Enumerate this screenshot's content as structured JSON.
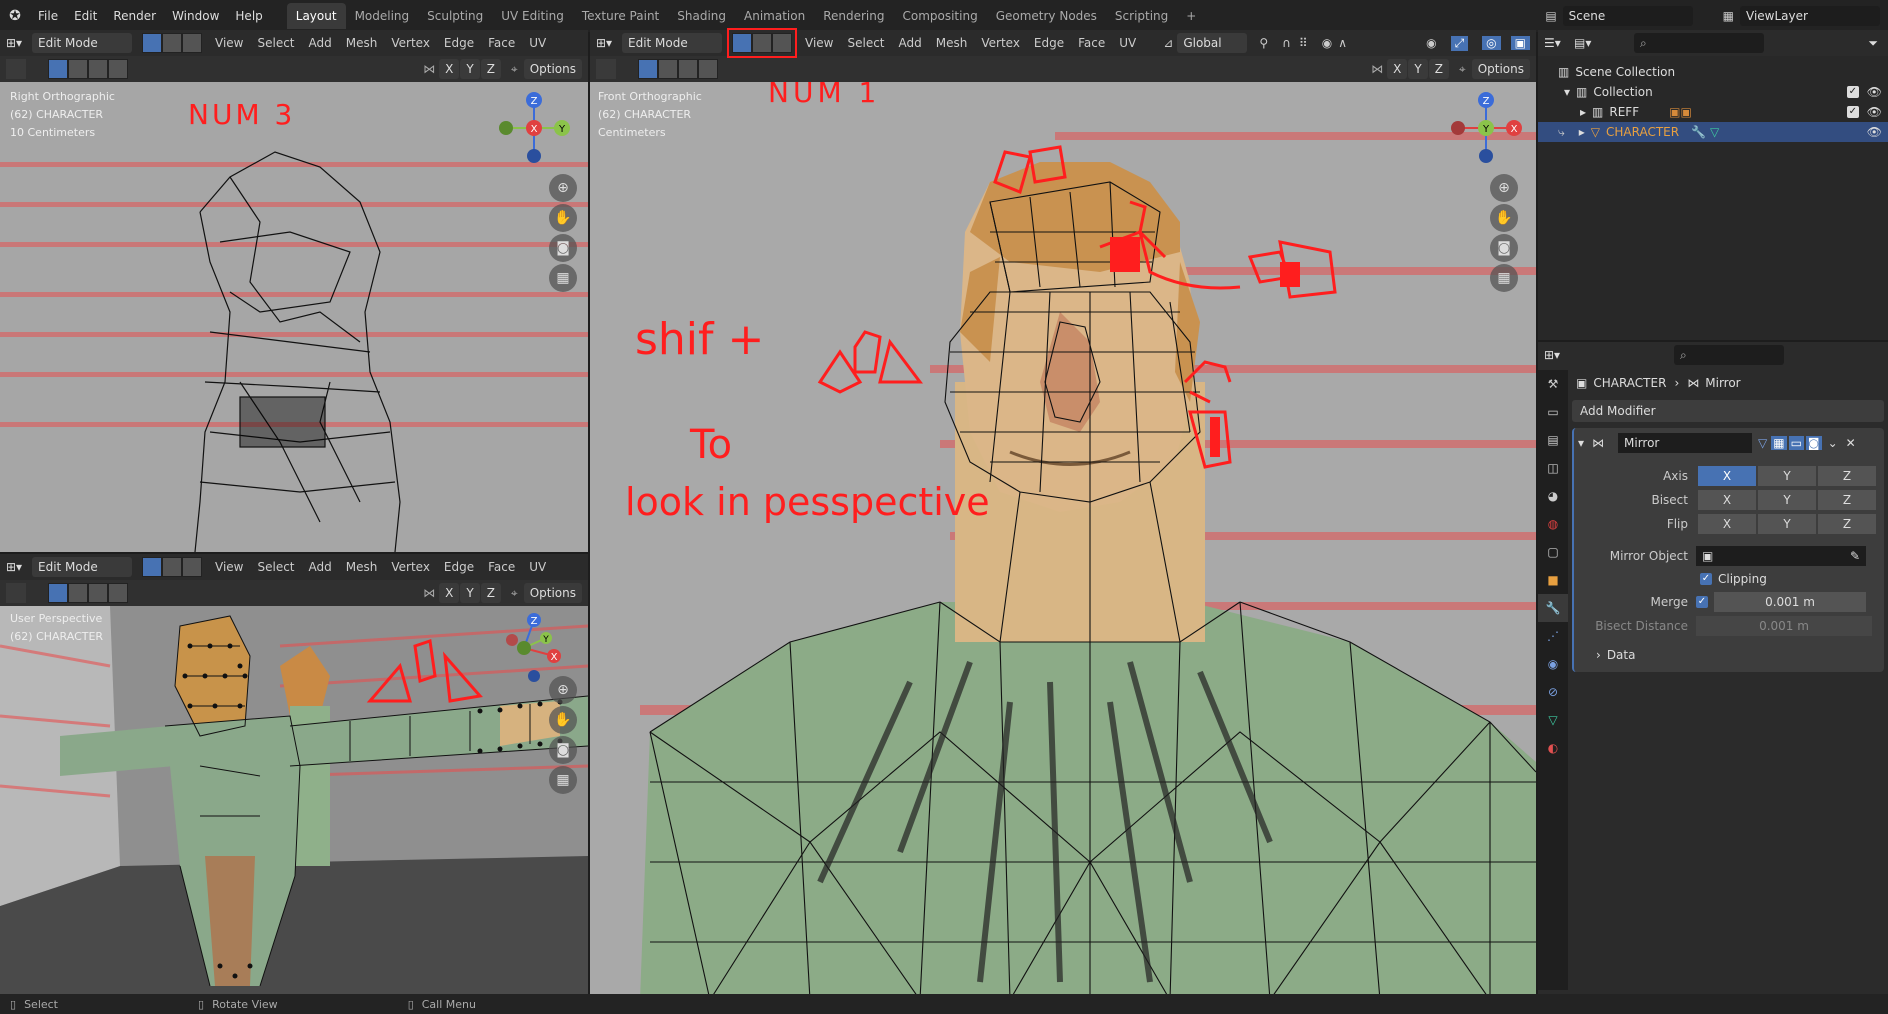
{
  "topbar": {
    "menus": [
      "File",
      "Edit",
      "Render",
      "Window",
      "Help"
    ],
    "workspaces": [
      "Layout",
      "Modeling",
      "Sculpting",
      "UV Editing",
      "Texture Paint",
      "Shading",
      "Animation",
      "Rendering",
      "Compositing",
      "Geometry Nodes",
      "Scripting"
    ],
    "active_workspace": "Layout",
    "add_tab": "+",
    "scene_label": "Scene",
    "viewlayer_label": "ViewLayer"
  },
  "viewport_header": {
    "mode": "Edit Mode",
    "menu": [
      "View",
      "Select",
      "Add",
      "Mesh",
      "Vertex",
      "Edge",
      "Face",
      "UV"
    ],
    "transform_orientation": "Global",
    "options": "Options",
    "axes": [
      "X",
      "Y",
      "Z"
    ]
  },
  "viewport_right": {
    "view_name": "Right Orthographic",
    "object": "(62) CHARACTER",
    "scale": "10 Centimeters",
    "annotation": "NUM 3"
  },
  "viewport_front": {
    "view_name": "Front Orthographic",
    "object": "(62) CHARACTER",
    "scale": "Centimeters",
    "annotation_top": "NUM 1",
    "annotation_line1": "shif +",
    "annotation_line2": "To",
    "annotation_line3": "look in pesspective"
  },
  "viewport_persp": {
    "view_name": "User Perspective",
    "object": "(62) CHARACTER"
  },
  "outliner": {
    "root": "Scene Collection",
    "collection": "Collection",
    "items": [
      "REFF",
      "CHARACTER"
    ]
  },
  "properties": {
    "breadcrumb_object": "CHARACTER",
    "breadcrumb_modifier": "Mirror",
    "add_modifier": "Add Modifier",
    "modifier_name": "Mirror",
    "axis_label": "Axis",
    "bisect_label": "Bisect",
    "flip_label": "Flip",
    "xyz": [
      "X",
      "Y",
      "Z"
    ],
    "mirror_object_label": "Mirror Object",
    "clipping_label": "Clipping",
    "merge_label": "Merge",
    "merge_value": "0.001 m",
    "bisect_distance_label": "Bisect Distance",
    "bisect_distance_value": "0.001 m",
    "data_label": "Data"
  },
  "status": {
    "select": "Select",
    "rotate": "Rotate View",
    "call_menu": "Call Menu"
  },
  "colors": {
    "accent": "#4772b3",
    "annotation": "#ff1e1e",
    "viewport_bg": "#a8a8a8",
    "selected_row": "#334d80"
  }
}
